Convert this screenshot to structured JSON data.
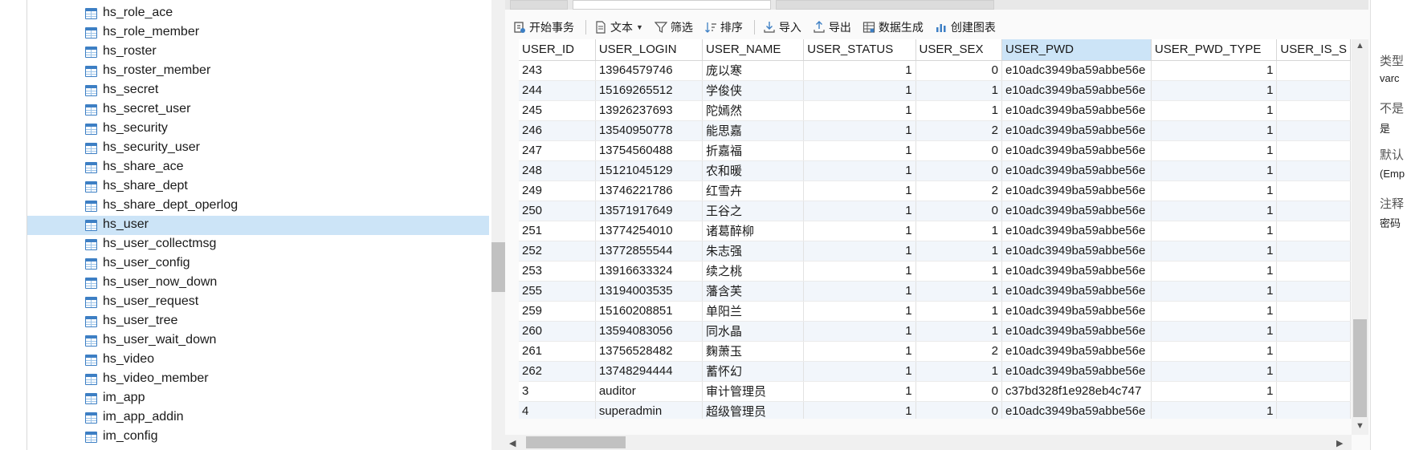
{
  "tree": {
    "items": [
      {
        "label": "hs_role_ace",
        "selected": false
      },
      {
        "label": "hs_role_member",
        "selected": false
      },
      {
        "label": "hs_roster",
        "selected": false
      },
      {
        "label": "hs_roster_member",
        "selected": false
      },
      {
        "label": "hs_secret",
        "selected": false
      },
      {
        "label": "hs_secret_user",
        "selected": false
      },
      {
        "label": "hs_security",
        "selected": false
      },
      {
        "label": "hs_security_user",
        "selected": false
      },
      {
        "label": "hs_share_ace",
        "selected": false
      },
      {
        "label": "hs_share_dept",
        "selected": false
      },
      {
        "label": "hs_share_dept_operlog",
        "selected": false
      },
      {
        "label": "hs_user",
        "selected": true
      },
      {
        "label": "hs_user_collectmsg",
        "selected": false
      },
      {
        "label": "hs_user_config",
        "selected": false
      },
      {
        "label": "hs_user_now_down",
        "selected": false
      },
      {
        "label": "hs_user_request",
        "selected": false
      },
      {
        "label": "hs_user_tree",
        "selected": false
      },
      {
        "label": "hs_user_wait_down",
        "selected": false
      },
      {
        "label": "hs_video",
        "selected": false
      },
      {
        "label": "hs_video_member",
        "selected": false
      },
      {
        "label": "im_app",
        "selected": false
      },
      {
        "label": "im_app_addin",
        "selected": false
      },
      {
        "label": "im_config",
        "selected": false
      }
    ]
  },
  "toolbar": {
    "begin_transaction": "开始事务",
    "text": "文本",
    "filter": "筛选",
    "sort": "排序",
    "import": "导入",
    "export": "导出",
    "generate_data": "数据生成",
    "create_chart": "创建图表"
  },
  "grid": {
    "columns": [
      "USER_ID",
      "USER_LOGIN",
      "USER_NAME",
      "USER_STATUS",
      "USER_SEX",
      "USER_PWD",
      "USER_PWD_TYPE",
      "USER_IS_S"
    ],
    "active_column": "USER_PWD",
    "current_row_marker_row": 18,
    "rows": [
      [
        "243",
        "13964579746",
        "庞以寒",
        "1",
        "0",
        "e10adc3949ba59abbe56e",
        "1",
        ""
      ],
      [
        "244",
        "15169265512",
        "学俊侠",
        "1",
        "1",
        "e10adc3949ba59abbe56e",
        "1",
        ""
      ],
      [
        "245",
        "13926237693",
        "陀嫣然",
        "1",
        "1",
        "e10adc3949ba59abbe56e",
        "1",
        ""
      ],
      [
        "246",
        "13540950778",
        "能思嘉",
        "1",
        "2",
        "e10adc3949ba59abbe56e",
        "1",
        ""
      ],
      [
        "247",
        "13754560488",
        "折嘉福",
        "1",
        "0",
        "e10adc3949ba59abbe56e",
        "1",
        ""
      ],
      [
        "248",
        "15121045129",
        "农和暖",
        "1",
        "0",
        "e10adc3949ba59abbe56e",
        "1",
        ""
      ],
      [
        "249",
        "13746221786",
        "红雪卉",
        "1",
        "2",
        "e10adc3949ba59abbe56e",
        "1",
        ""
      ],
      [
        "250",
        "13571917649",
        "王谷之",
        "1",
        "0",
        "e10adc3949ba59abbe56e",
        "1",
        ""
      ],
      [
        "251",
        "13774254010",
        "诸葛醉柳",
        "1",
        "1",
        "e10adc3949ba59abbe56e",
        "1",
        ""
      ],
      [
        "252",
        "13772855544",
        "朱志强",
        "1",
        "1",
        "e10adc3949ba59abbe56e",
        "1",
        ""
      ],
      [
        "253",
        "13916633324",
        "续之桃",
        "1",
        "1",
        "e10adc3949ba59abbe56e",
        "1",
        ""
      ],
      [
        "255",
        "13194003535",
        "藩含芙",
        "1",
        "1",
        "e10adc3949ba59abbe56e",
        "1",
        ""
      ],
      [
        "259",
        "15160208851",
        "单阳兰",
        "1",
        "1",
        "e10adc3949ba59abbe56e",
        "1",
        ""
      ],
      [
        "260",
        "13594083056",
        "同水晶",
        "1",
        "1",
        "e10adc3949ba59abbe56e",
        "1",
        ""
      ],
      [
        "261",
        "13756528482",
        "麴萧玉",
        "1",
        "2",
        "e10adc3949ba59abbe56e",
        "1",
        ""
      ],
      [
        "262",
        "13748294444",
        "蓄怀幻",
        "1",
        "1",
        "e10adc3949ba59abbe56e",
        "1",
        ""
      ],
      [
        "3",
        "auditor",
        "审计管理员",
        "1",
        "0",
        "c37bd328f1e928eb4c747",
        "1",
        ""
      ],
      [
        "4",
        "superadmin",
        "超级管理员",
        "1",
        "0",
        "e10adc3949ba59abbe56e",
        "1",
        ""
      ]
    ]
  },
  "info": {
    "type_label": "类型",
    "type_value": "varc",
    "not_null_label": "不是",
    "not_null_value": "是",
    "default_label": "默认",
    "default_value": "(Emp",
    "comment_label": "注释",
    "comment_value": "密码"
  }
}
